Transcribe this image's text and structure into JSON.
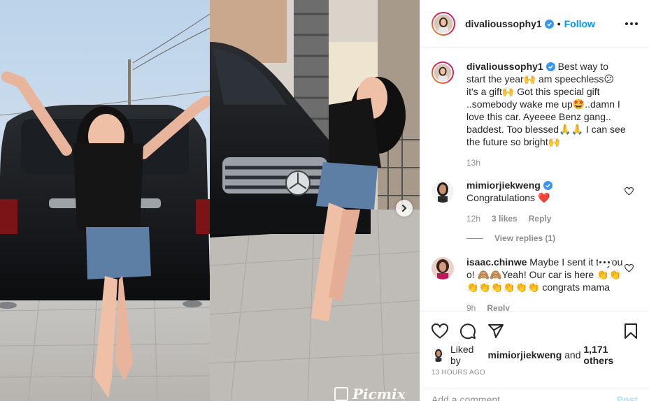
{
  "post": {
    "username": "divalioussophy1",
    "follow_label": "Follow",
    "watermark": "Picmix"
  },
  "caption": {
    "username": "divalioussophy1",
    "text": "Best way to start the year🙌 am speechless😕 it's a gift🙌 Got this special gift ..somebody wake me up🤩..damn I love this car. Ayeeee Benz gang.. baddest. Too blessed🙏🙏 I can see the future so bright🙌",
    "time": "13h"
  },
  "comments": [
    {
      "username": "mimiorjiekweng",
      "text": "Congratulations ❤️",
      "time": "12h",
      "likes": "3 likes",
      "reply_label": "Reply",
      "view_replies": "View replies (1)"
    },
    {
      "username": "isaac.chinwe",
      "text": "Maybe I sent it to you o! 🙈🙈Yeah! Our car is here 👏👏👏👏👏👏👏👏 congrats mama",
      "time": "9h",
      "reply_label": "Reply"
    }
  ],
  "likes": {
    "prefix": "Liked by",
    "user": "mimiorjiekweng",
    "joiner": "and",
    "others": "1,171 others"
  },
  "timestamp": "13 HOURS AGO",
  "add_comment": {
    "placeholder": "Add a comment...",
    "post_label": "Post"
  },
  "colors": {
    "accent": "#0095f6",
    "verified": "#3897f0",
    "muted": "#8e8e8e",
    "heart": "#ed4956",
    "post_disabled": "#b2dffc"
  },
  "icons": [
    "verified-icon",
    "more-options-icon",
    "heart-outline-icon",
    "comment-icon",
    "share-icon",
    "bookmark-icon",
    "carousel-next-icon"
  ]
}
